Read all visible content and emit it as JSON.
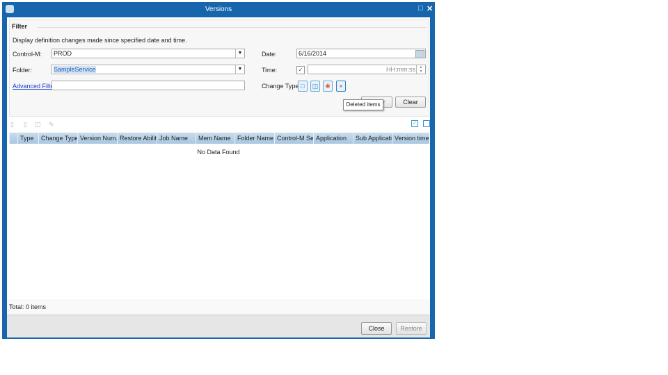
{
  "window": {
    "title": "Versions",
    "controls": [
      "restore",
      "close"
    ]
  },
  "filter": {
    "legend": "Filter",
    "description": "Display definition changes made since specified date and time.",
    "controlm_label": "Control-M:",
    "controlm_value": "PROD",
    "folder_label": "Folder:",
    "folder_value": "SampleService",
    "advanced_filter_link": "Advanced Filter",
    "advanced_filter_value": "",
    "date_label": "Date:",
    "date_value": "6/16/2014",
    "time_label": "Time:",
    "time_checked": true,
    "time_placeholder": "HH:mm:ss",
    "change_type_label": "Change Type:",
    "change_type_icons": [
      "new-item-icon",
      "modified-item-icon",
      "restored-item-icon",
      "deleted-item-icon"
    ],
    "apply_label": "Apply",
    "clear_label": "Clear",
    "tooltip": "Deleted items"
  },
  "table": {
    "columns": [
      "",
      "Type",
      "Change Type",
      "Version Num...",
      "Restore Ability",
      "Job Name",
      "Mem Name",
      "Folder Name",
      "Control-M Se...",
      "Application",
      "Sub Applicati...",
      "Version time..."
    ],
    "empty_text": "No Data Found",
    "total": "Total: 0 items"
  },
  "footer": {
    "close_label": "Close",
    "restore_label": "Restore"
  },
  "colors": {
    "accent": "#1766ad",
    "header": "#b5d0e6",
    "link": "#1a3fcf",
    "selection": "#cfe3f5"
  }
}
